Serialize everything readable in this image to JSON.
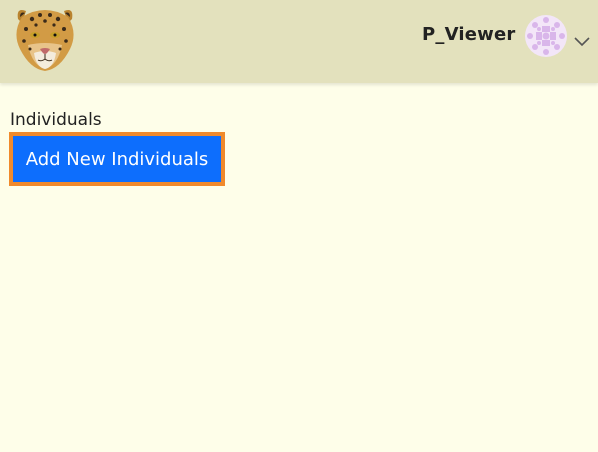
{
  "header": {
    "logo_icon": "leopard-logo-icon",
    "username": "P_Viewer",
    "avatar_icon": "avatar-identicon-icon",
    "menu_icon": "chevron-down-icon"
  },
  "main": {
    "section_title": "Individuals",
    "add_button_label": "Add New Individuals"
  },
  "colors": {
    "header_bg": "#e3e1bd",
    "page_bg": "#fefee9",
    "button_bg": "#0d6efd",
    "button_focus_border": "#f08a2c"
  }
}
